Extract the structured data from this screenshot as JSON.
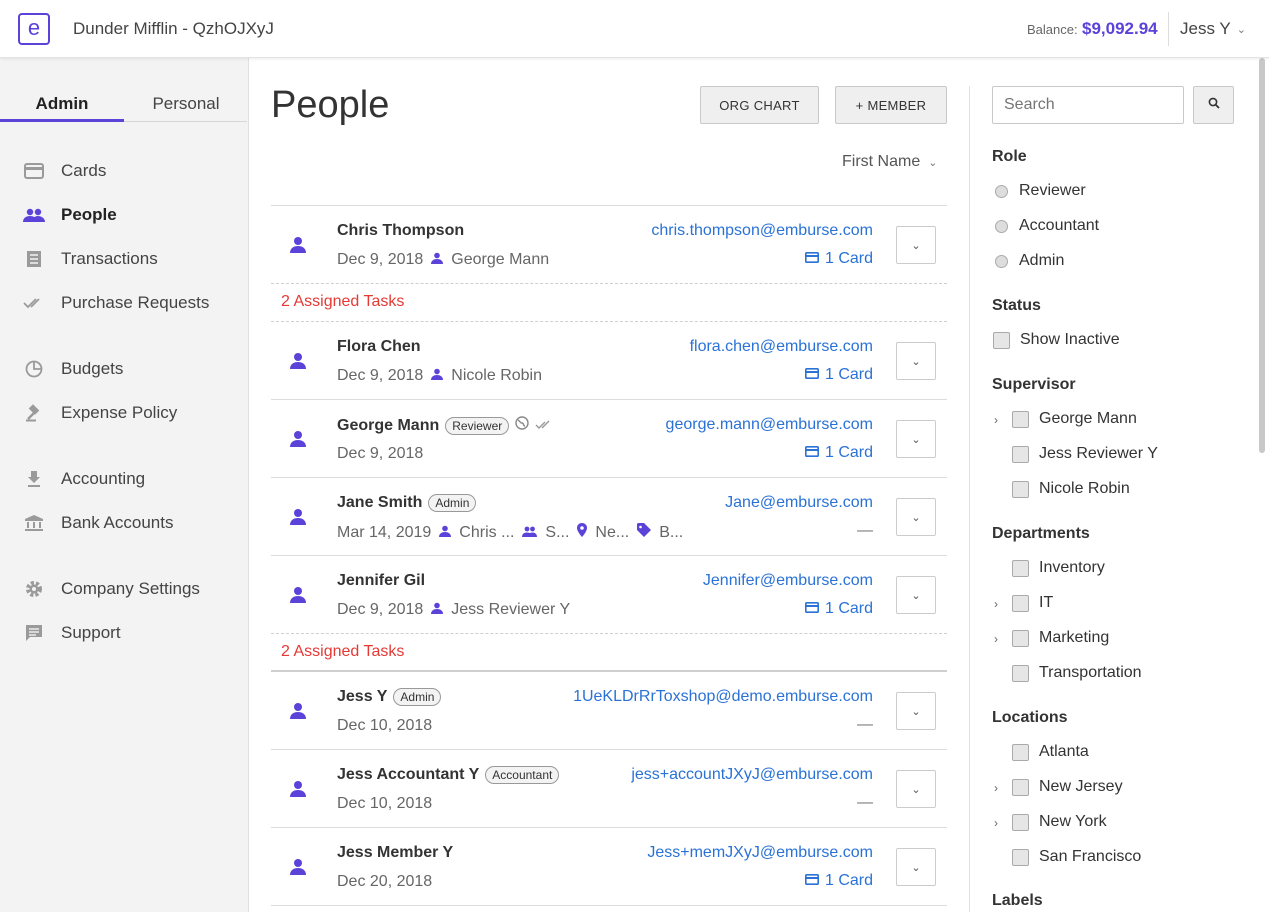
{
  "header": {
    "logo_glyph": "e",
    "company": "Dunder Mifflin - QzhOJXyJ",
    "balance_label": "Balance:",
    "balance_value": "$9,092.94",
    "user": "Jess Y"
  },
  "sidebar": {
    "tabs": [
      "Admin",
      "Personal"
    ],
    "items": [
      {
        "label": "Cards",
        "icon": "credit-card-icon"
      },
      {
        "label": "People",
        "icon": "people-icon"
      },
      {
        "label": "Transactions",
        "icon": "receipt-icon"
      },
      {
        "label": "Purchase Requests",
        "icon": "double-check-icon"
      },
      {
        "label": "Budgets",
        "icon": "pie-chart-icon"
      },
      {
        "label": "Expense Policy",
        "icon": "gavel-icon"
      },
      {
        "label": "Accounting",
        "icon": "download-icon"
      },
      {
        "label": "Bank Accounts",
        "icon": "bank-icon"
      },
      {
        "label": "Company Settings",
        "icon": "gear-icon"
      },
      {
        "label": "Support",
        "icon": "chat-icon"
      }
    ]
  },
  "main": {
    "title": "People",
    "org_chart_label": "ORG CHART",
    "add_member_label": "+ MEMBER",
    "sort_label": "First Name",
    "tasks_label": "2 Assigned Tasks",
    "rows": [
      {
        "name": "Chris Thompson",
        "date": "Dec 9, 2018",
        "supervisor": "George Mann",
        "email": "chris.thompson@emburse.com",
        "cards": "1 Card"
      },
      {
        "name": "Flora Chen",
        "date": "Dec 9, 2018",
        "supervisor": "Nicole Robin",
        "email": "flora.chen@emburse.com",
        "cards": "1 Card"
      },
      {
        "name": "George Mann",
        "badge": "Reviewer",
        "date": "Dec 9, 2018",
        "email": "george.mann@emburse.com",
        "cards": "1 Card"
      },
      {
        "name": "Jane Smith",
        "badge": "Admin",
        "date": "Mar 14, 2019",
        "supervisor": "Chris ...",
        "department": "S...",
        "location": "Ne...",
        "label": "B...",
        "email": "Jane@emburse.com",
        "cards": "—"
      },
      {
        "name": "Jennifer Gil",
        "date": "Dec 9, 2018",
        "supervisor": "Jess Reviewer Y",
        "email": "Jennifer@emburse.com",
        "cards": "1 Card"
      },
      {
        "name": "Jess Y",
        "badge": "Admin",
        "date": "Dec 10, 2018",
        "email": "1UeKLDrRrToxshop@demo.emburse.com",
        "cards": "—"
      },
      {
        "name": "Jess Accountant Y",
        "badge": "Accountant",
        "date": "Dec 10, 2018",
        "email": "jess+accountJXyJ@emburse.com",
        "cards": "—"
      },
      {
        "name": "Jess Member Y",
        "date": "Dec 20, 2018",
        "email": "Jess+memJXyJ@emburse.com",
        "cards": "1 Card"
      }
    ]
  },
  "filters": {
    "search_placeholder": "Search",
    "role_heading": "Role",
    "roles": [
      "Reviewer",
      "Accountant",
      "Admin"
    ],
    "status_heading": "Status",
    "show_inactive": "Show Inactive",
    "supervisor_heading": "Supervisor",
    "supervisors": [
      "George Mann",
      "Jess Reviewer Y",
      "Nicole Robin"
    ],
    "departments_heading": "Departments",
    "departments": [
      "Inventory",
      "IT",
      "Marketing",
      "Transportation"
    ],
    "locations_heading": "Locations",
    "locations": [
      "Atlanta",
      "New Jersey",
      "New York",
      "San Francisco"
    ],
    "labels_heading": "Labels"
  },
  "colors": {
    "accent": "#5b42d9",
    "link": "#2a72d6",
    "tasks": "#e53935"
  }
}
